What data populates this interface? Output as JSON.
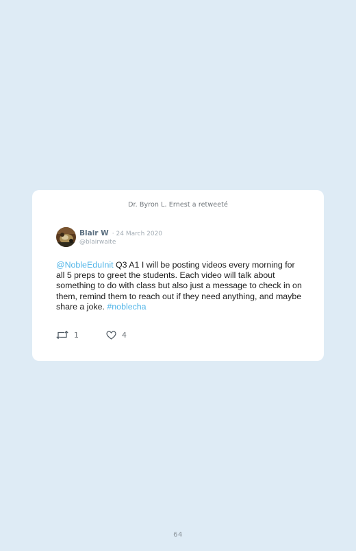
{
  "retweet_note": "Dr. Byron L. Ernest a retweeté",
  "tweet": {
    "author_name": "Blair W",
    "date": "· 24 March 2020",
    "handle": "@blairwaite",
    "mention": "@NobleEduInit",
    "text": " Q3 A1 I will be posting videos every morning for all 5 preps to greet the students. Each video will talk about something to do with class but also just a message to check in on them, remind them to reach out if they need anything, and maybe share a joke. ",
    "hashtag": "#noblecha",
    "retweets": "1",
    "likes": "4"
  },
  "icons": {
    "retweet": "retweet-icon",
    "like": "heart-icon",
    "avatar": "avatar-photo"
  },
  "colors": {
    "background": "#deebf5",
    "card": "#ffffff",
    "link": "#4fb4e8",
    "author_name": "#5b6f80",
    "muted": "#a3acb4"
  },
  "page_number": "64"
}
